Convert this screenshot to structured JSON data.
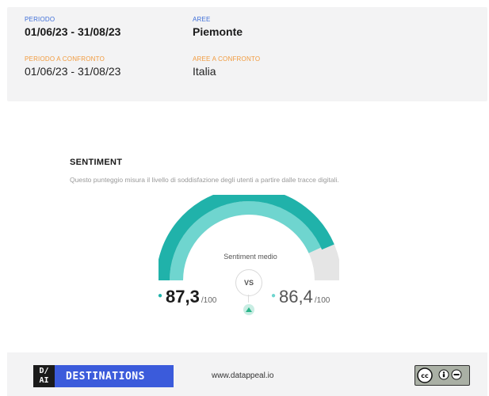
{
  "filters": {
    "period_label": "PERIODO",
    "period_value": "01/06/23 - 31/08/23",
    "areas_label": "AREE",
    "areas_value": "Piemonte",
    "compare_period_label": "PERIODO A CONFRONTO",
    "compare_period_value": "01/06/23 - 31/08/23",
    "compare_areas_label": "AREE A CONFRONTO",
    "compare_areas_value": "Italia"
  },
  "sentiment": {
    "title": "SENTIMENT",
    "description": "Questo punteggio misura il livello di soddisfazione degli utenti a partire dalle tracce digitali.",
    "gauge_label": "Sentiment medio",
    "vs_label": "VS",
    "primary_value": "87,3",
    "primary_max": "/100",
    "primary_fraction": 0.873,
    "compare_value": "86,4",
    "compare_max": "/100",
    "compare_fraction": 0.864,
    "trend": "up",
    "colors": {
      "primary": "#20b2aa",
      "compare": "#6fd5cf",
      "track": "#e5e5e5"
    }
  },
  "footer": {
    "logo_mark": "D/\nAI",
    "brand": "DESTINATIONS",
    "website": "www.datappeal.io",
    "license_icon": "cc-by-nc-icon",
    "brand_color": "#3b5bdb"
  }
}
